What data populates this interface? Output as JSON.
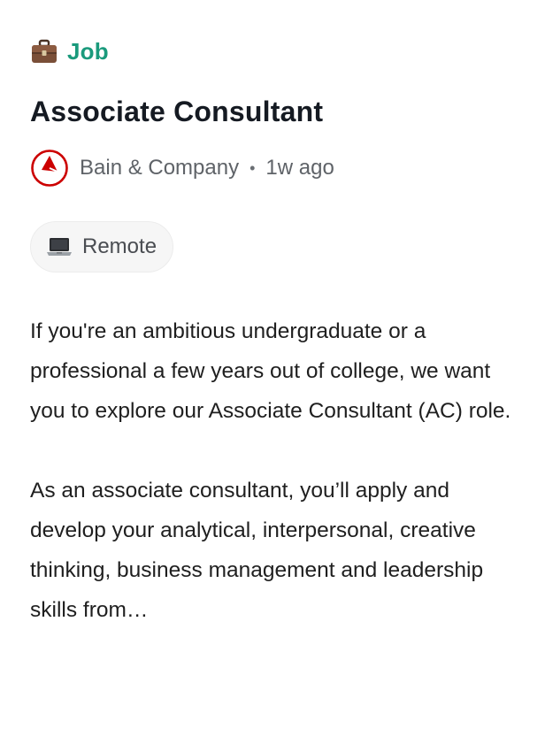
{
  "post": {
    "type_label": "Job",
    "type_icon": "briefcase-icon",
    "title": "Associate Consultant",
    "company": "Bain & Company",
    "separator": "•",
    "posted_ago": "1w ago",
    "location_chip": {
      "icon": "laptop-icon",
      "label": "Remote"
    },
    "description": [
      "If you're an ambitious undergraduate or a professional a few years out of college, we want you to explore our Associate Consultant (AC) role.",
      "As an associate consultant, you’ll apply and develop your analytical, interpersonal, creative thinking, business management and leadership skills from…"
    ]
  },
  "colors": {
    "accent": "#1a9a7c",
    "title": "#151a22",
    "muted": "#5f6368",
    "brand_logo": "#cc0000",
    "chip_bg": "#f6f6f6"
  }
}
